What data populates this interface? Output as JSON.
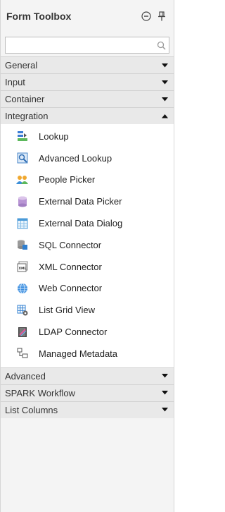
{
  "toolbox": {
    "title": "Form Toolbox",
    "search": {
      "value": "",
      "placeholder": ""
    },
    "sections_top": [
      {
        "label": "General",
        "expanded": false
      },
      {
        "label": "Input",
        "expanded": false
      },
      {
        "label": "Container",
        "expanded": false
      },
      {
        "label": "Integration",
        "expanded": true
      }
    ],
    "integration_items": [
      {
        "label": "Lookup",
        "icon": "lookup-icon"
      },
      {
        "label": "Advanced Lookup",
        "icon": "advanced-lookup-icon"
      },
      {
        "label": "People Picker",
        "icon": "people-picker-icon"
      },
      {
        "label": "External Data Picker",
        "icon": "database-icon"
      },
      {
        "label": "External Data Dialog",
        "icon": "calendar-grid-icon"
      },
      {
        "label": "SQL Connector",
        "icon": "sql-connector-icon"
      },
      {
        "label": "XML Connector",
        "icon": "xml-document-icon"
      },
      {
        "label": "Web Connector",
        "icon": "globe-icon"
      },
      {
        "label": "List Grid View",
        "icon": "grid-view-icon"
      },
      {
        "label": "LDAP Connector",
        "icon": "ldap-book-icon"
      },
      {
        "label": "Managed Metadata",
        "icon": "tag-tree-icon"
      }
    ],
    "sections_bottom": [
      {
        "label": "Advanced",
        "expanded": false
      },
      {
        "label": "SPARK Workflow",
        "expanded": false
      },
      {
        "label": "List Columns",
        "expanded": false
      }
    ]
  },
  "colors": {
    "header_bg": "#f4f4f4",
    "section_bg": "#e9e9e9",
    "accent_blue": "#2f7fd0"
  }
}
